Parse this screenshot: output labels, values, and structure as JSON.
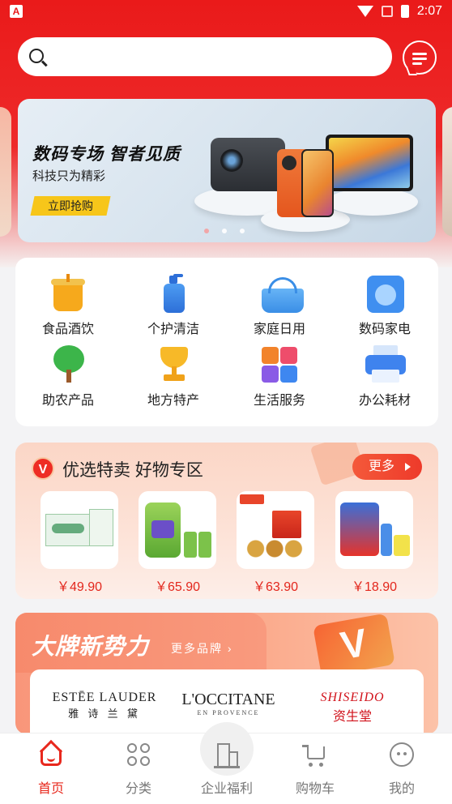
{
  "status_bar": {
    "time": "2:07"
  },
  "search": {
    "placeholder": ""
  },
  "banner": {
    "title": "数码专场  智者见质",
    "subtitle": "科技只为精彩",
    "button": "立即抢购",
    "page_count": 3,
    "active_page": 1
  },
  "categories": [
    {
      "label": "食品酒饮",
      "icon": "drink-cup-icon"
    },
    {
      "label": "个护清洁",
      "icon": "soap-bottle-icon"
    },
    {
      "label": "家庭日用",
      "icon": "basket-icon"
    },
    {
      "label": "数码家电",
      "icon": "washing-machine-icon"
    },
    {
      "label": "助农产品",
      "icon": "tree-icon"
    },
    {
      "label": "地方特产",
      "icon": "trophy-icon"
    },
    {
      "label": "生活服务",
      "icon": "services-icon"
    },
    {
      "label": "办公耗材",
      "icon": "printer-icon"
    }
  ],
  "offer": {
    "badge": "V",
    "title": "优选特卖  好物专区",
    "more": "更多",
    "products": [
      {
        "price": "￥49.90",
        "image": "milk-box"
      },
      {
        "price": "￥65.90",
        "image": "detergent"
      },
      {
        "price": "￥63.90",
        "image": "mooncake-gift"
      },
      {
        "price": "￥18.90",
        "image": "laundry-set"
      }
    ]
  },
  "brand": {
    "title": "大牌新势力",
    "more": "更多品牌",
    "v_badge": "V",
    "logos": [
      {
        "top": "ESTĒE LAUDER",
        "bottom": "雅 诗 兰 黛"
      },
      {
        "top": "L'OCCITANE",
        "bottom": "EN PROVENCE"
      },
      {
        "top": "SHISEIDO",
        "bottom": "资生堂"
      }
    ]
  },
  "bottom_nav": [
    {
      "label": "首页",
      "icon": "home-icon",
      "active": true
    },
    {
      "label": "分类",
      "icon": "category-icon",
      "active": false
    },
    {
      "label": "企业福利",
      "icon": "building-icon",
      "active": false
    },
    {
      "label": "购物车",
      "icon": "cart-icon",
      "active": false
    },
    {
      "label": "我的",
      "icon": "profile-icon",
      "active": false
    }
  ],
  "colors": {
    "brand_red": "#ea1a1a",
    "price_red": "#e3261c",
    "accent_yellow": "#f7c61a"
  }
}
